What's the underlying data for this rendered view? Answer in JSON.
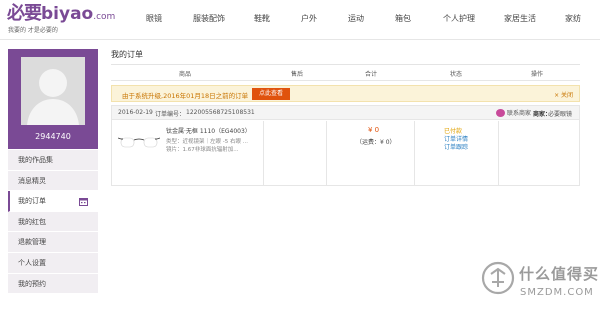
{
  "brand": {
    "logo_cn": "必要",
    "logo_en": "biyao",
    "logo_domain": ".com",
    "slogan": "我要的 才是必要的"
  },
  "nav": {
    "items": [
      "眼镜",
      "服装配饰",
      "鞋靴",
      "户外",
      "运动",
      "箱包",
      "个人护理",
      "家居生活",
      "家纺"
    ]
  },
  "sidebar": {
    "username": "2944740",
    "menu": [
      {
        "label": "我的作品集"
      },
      {
        "label": "消息精灵"
      },
      {
        "label": "我的订单",
        "active": true
      },
      {
        "label": "我的红包"
      },
      {
        "label": "退款管理"
      },
      {
        "label": "个人设置"
      },
      {
        "label": "我的预约"
      }
    ]
  },
  "main": {
    "title": "我的订单",
    "columns": [
      "商品",
      "售后",
      "合计",
      "状态",
      "操作"
    ],
    "notice": {
      "text": "由于系统升级,2016年01月18日之前的订单",
      "button": "点此查看",
      "close": "× 关闭"
    },
    "order": {
      "date": "2016-02-19",
      "number_label": "订单编号：",
      "number": "122005568725108531",
      "contact": "联系商家",
      "shop_label": "商家：",
      "shop": "必要眼镜",
      "product_name": "钛金属·无框 1110（EG4003）",
      "product_type": "类型：近视镜架｜左眼 -5 右眼 ...",
      "product_lens": "镜片：1.67非球面抗辐射加...",
      "price": "¥ 0",
      "shipping": "（运费：¥ 0）",
      "status": "已付款",
      "actions": [
        "订单详情",
        "订单跟踪"
      ]
    }
  },
  "watermark": {
    "cn": "什么值得买",
    "en": "SMZDM.COM"
  },
  "colors": {
    "brand_purple": "#7a4a95",
    "notice_bg": "#fbf3d9",
    "accent_orange": "#e0530d",
    "link_blue": "#2a7fc2"
  }
}
